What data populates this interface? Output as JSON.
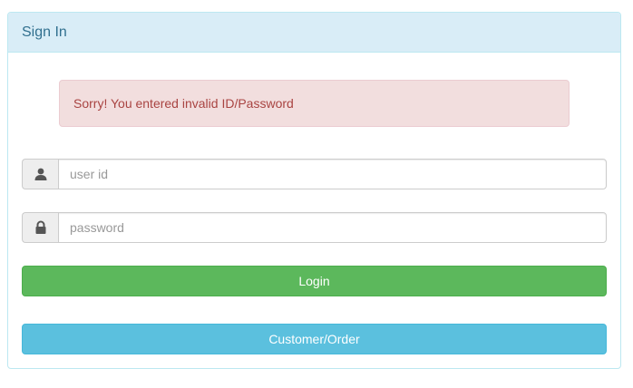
{
  "panel": {
    "title": "Sign In"
  },
  "alert": {
    "message": "Sorry! You entered invalid ID/Password"
  },
  "form": {
    "userid": {
      "value": "",
      "placeholder": "user id",
      "icon": "user-icon"
    },
    "password": {
      "value": "",
      "placeholder": "password",
      "icon": "lock-icon"
    },
    "login_label": "Login",
    "customer_label": "Customer/Order"
  },
  "colors": {
    "heading_bg": "#d9edf7",
    "heading_text": "#31708f",
    "alert_bg": "#f2dede",
    "alert_text": "#a94442",
    "success": "#5cb85c",
    "info": "#5bc0de"
  }
}
